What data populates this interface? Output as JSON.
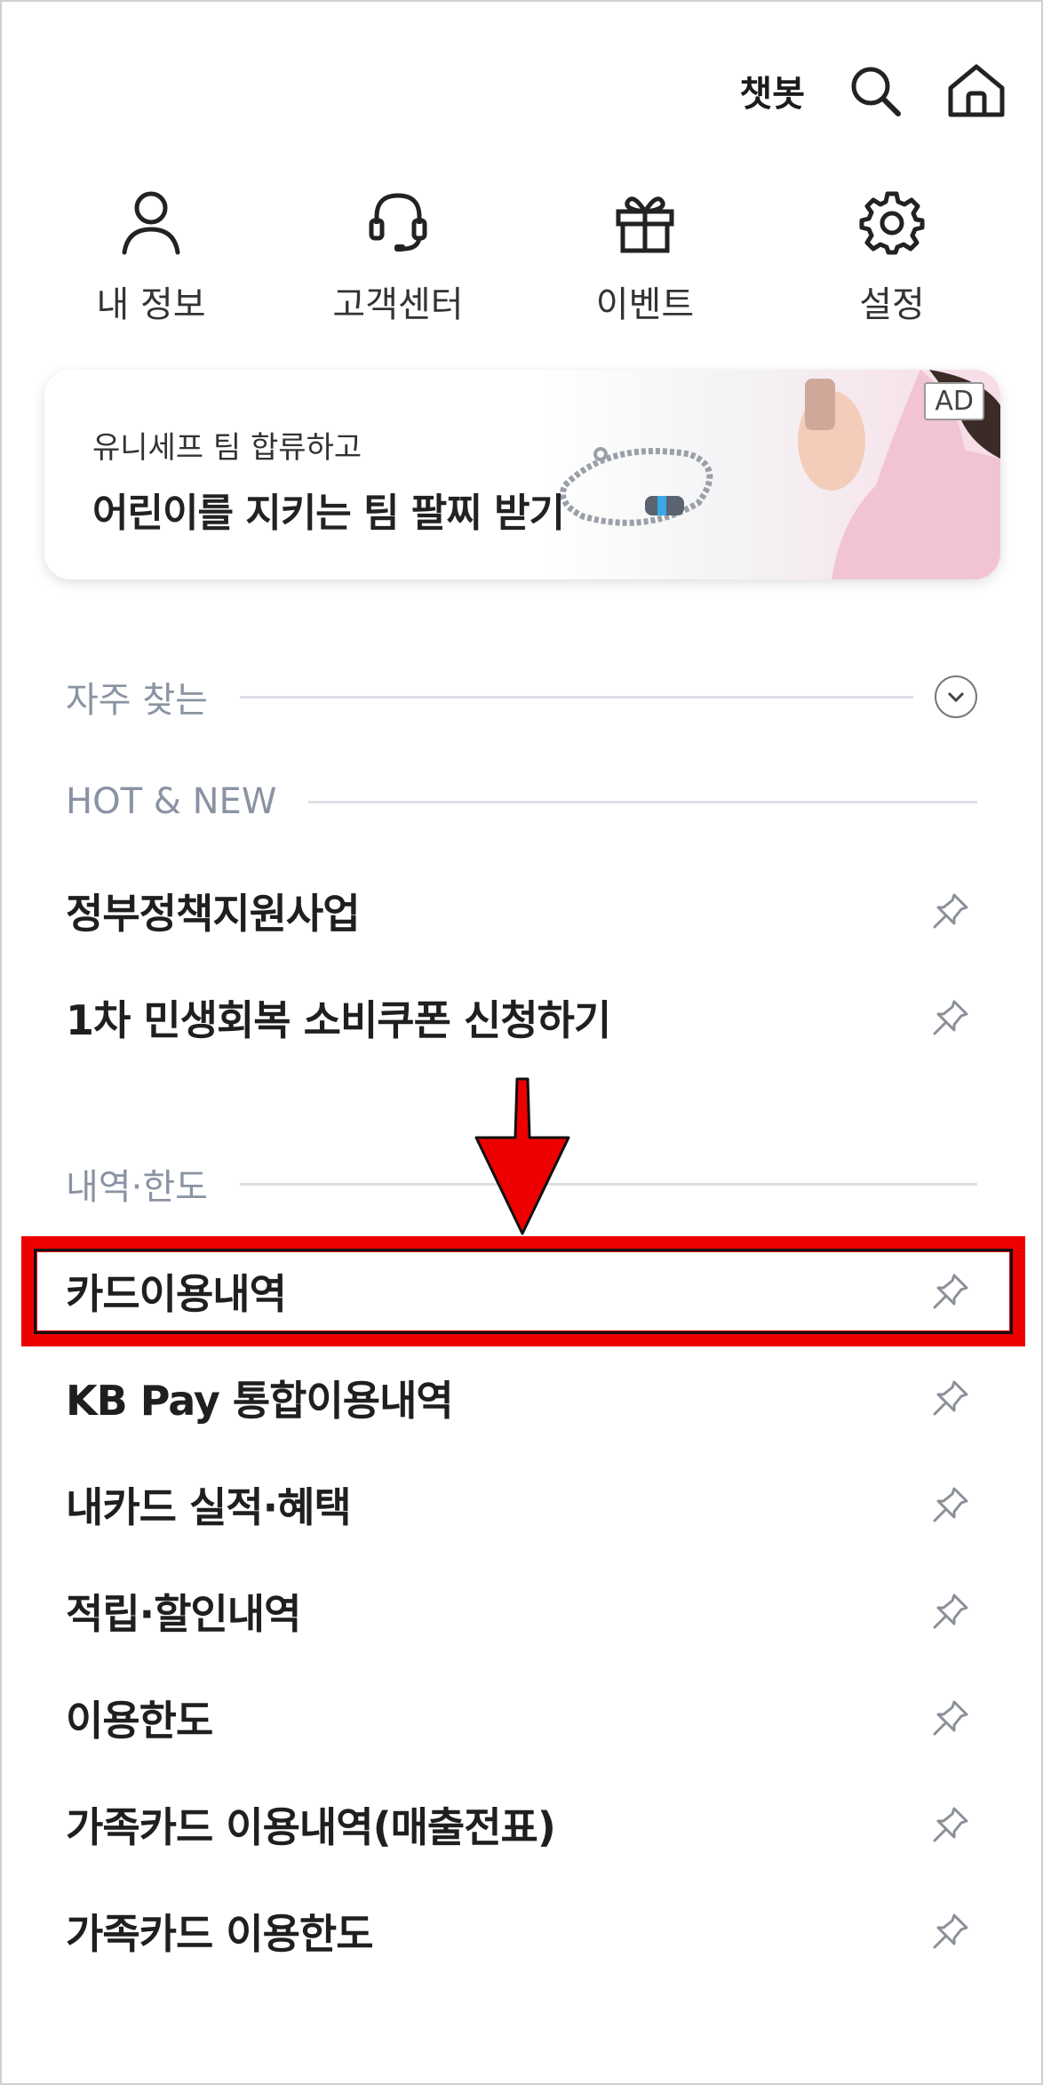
{
  "header": {
    "chatbot_label": "챗봇",
    "search_icon": "search-icon",
    "home_icon": "home-icon"
  },
  "quick_menu": [
    {
      "label": "내 정보",
      "icon": "user-icon"
    },
    {
      "label": "고객센터",
      "icon": "headset-icon"
    },
    {
      "label": "이벤트",
      "icon": "gift-icon"
    },
    {
      "label": "설정",
      "icon": "gear-icon"
    }
  ],
  "ad": {
    "badge": "AD",
    "subtitle": "유니세프 팀 합류하고",
    "title": "어린이를 지키는 팀 팔찌 받기"
  },
  "frequent": {
    "title": "자주 찾는"
  },
  "hot_new": {
    "title": "HOT & NEW",
    "items": [
      "정부정책지원사업",
      "1차 민생회복 소비쿠폰 신청하기"
    ]
  },
  "history_limit": {
    "title": "내역·한도",
    "items": [
      "카드이용내역",
      "KB Pay 통합이용내역",
      "내카드 실적·혜택",
      "적립·할인내역",
      "이용한도",
      "가족카드 이용내역(매출전표)",
      "가족카드 이용한도"
    ]
  },
  "colors": {
    "highlight": "#ee0000",
    "section_title": "#8a93a3",
    "text": "#1f1f1f"
  }
}
